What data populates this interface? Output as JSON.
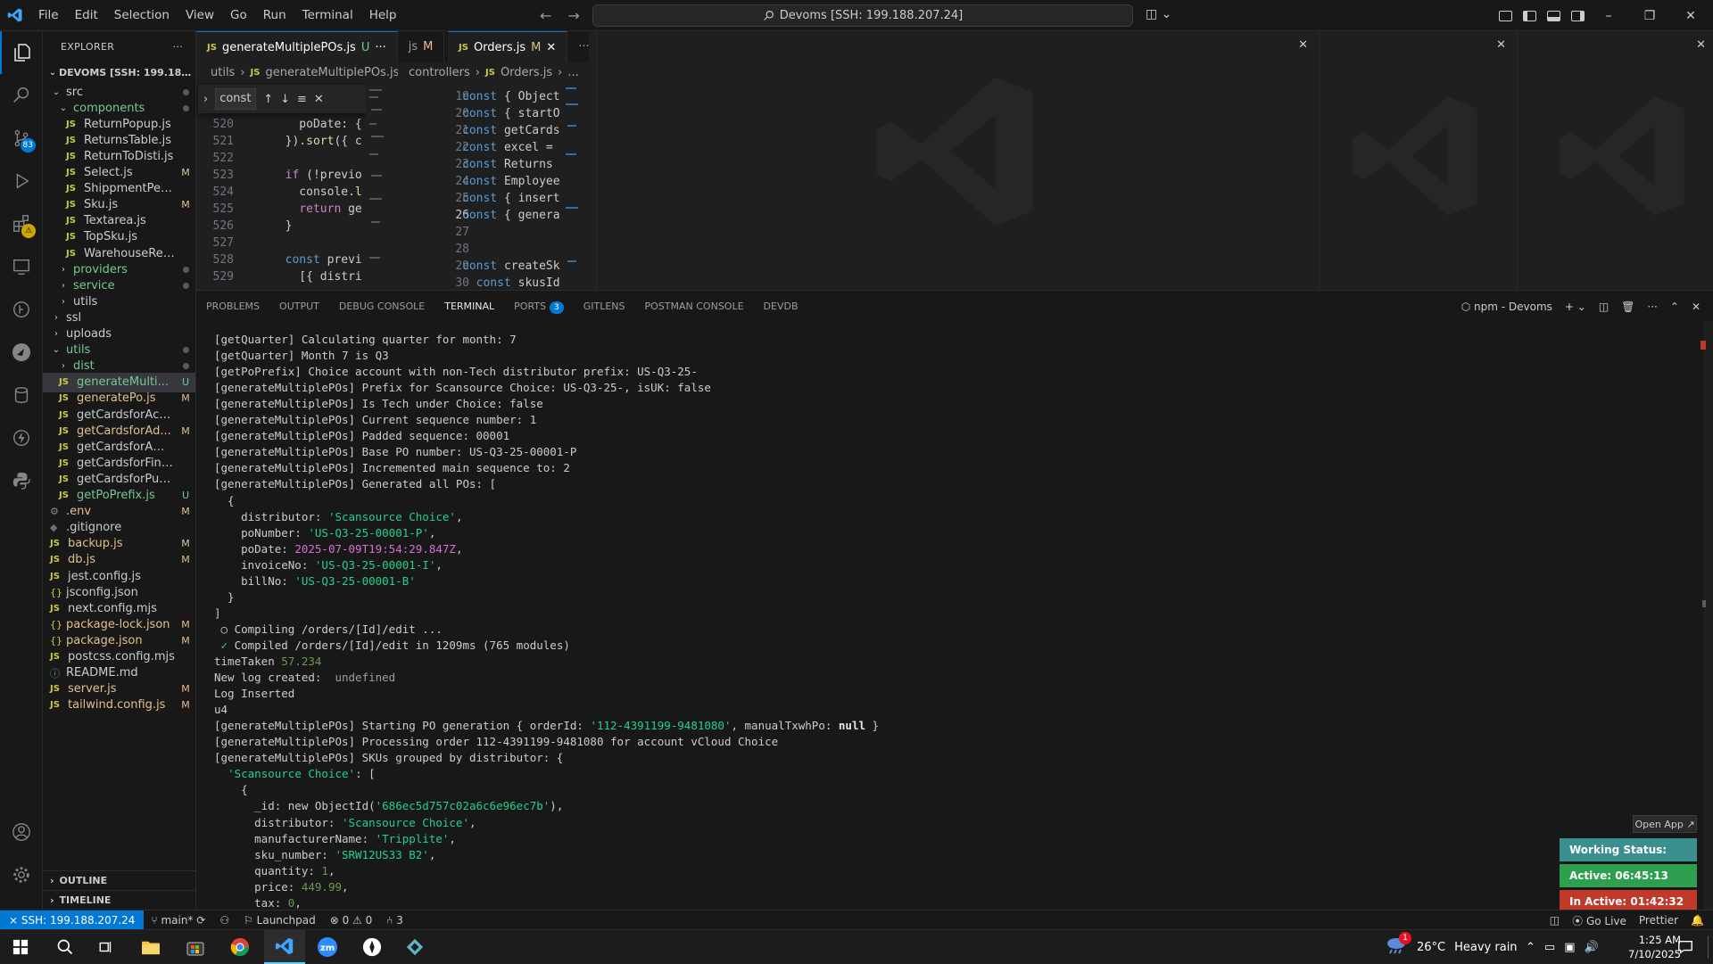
{
  "window": {
    "menu": [
      "File",
      "Edit",
      "Selection",
      "View",
      "Go",
      "Run",
      "Terminal",
      "Help"
    ],
    "command_center": "Devoms [SSH: 199.188.207.24]",
    "controls": {
      "minimize": "–",
      "restore": "❐",
      "close": "✕"
    }
  },
  "explorer": {
    "title": "EXPLORER",
    "root": "DEVOMS [SSH: 199.188.20...",
    "items": [
      {
        "label": "src",
        "type": "folder-open",
        "status": "dot"
      },
      {
        "label": "components",
        "type": "folder-open",
        "status": "dot",
        "mod": true
      },
      {
        "label": "ReturnPopup.js",
        "type": "js",
        "status": ""
      },
      {
        "label": "ReturnsTable.js",
        "type": "js",
        "status": ""
      },
      {
        "label": "ReturnToDisti.js",
        "type": "js",
        "status": ""
      },
      {
        "label": "Select.js",
        "type": "js",
        "status": "M"
      },
      {
        "label": "ShippmentPending...",
        "type": "js",
        "status": ""
      },
      {
        "label": "Sku.js",
        "type": "js",
        "status": "M"
      },
      {
        "label": "Textarea.js",
        "type": "js",
        "status": ""
      },
      {
        "label": "TopSku.js",
        "type": "js",
        "status": ""
      },
      {
        "label": "WarehouseReturn.js",
        "type": "js",
        "status": ""
      },
      {
        "label": "providers",
        "type": "folder",
        "status": "dot",
        "mod": true
      },
      {
        "label": "service",
        "type": "folder",
        "status": "dot",
        "mod": true
      },
      {
        "label": "utils",
        "type": "folder",
        "status": ""
      },
      {
        "label": "ssl",
        "type": "folder",
        "status": ""
      },
      {
        "label": "uploads",
        "type": "folder",
        "status": ""
      },
      {
        "label": "utils",
        "type": "folder-open",
        "status": "dot",
        "mod": true
      },
      {
        "label": "dist",
        "type": "folder",
        "status": "dot",
        "mod": true
      },
      {
        "label": "generateMulti...",
        "type": "js",
        "status": "U",
        "unt": true,
        "selected": true
      },
      {
        "label": "generatePo.js",
        "type": "js",
        "status": "M",
        "mod": true
      },
      {
        "label": "getCardsforAccount.js",
        "type": "js",
        "status": ""
      },
      {
        "label": "getCardsforAd...",
        "type": "js",
        "status": "M",
        "mod": true
      },
      {
        "label": "getCardsforAmazon.js",
        "type": "js",
        "status": ""
      },
      {
        "label": "getCardsforFinance.js",
        "type": "js",
        "status": ""
      },
      {
        "label": "getCardsforPurchasi...",
        "type": "js",
        "status": ""
      },
      {
        "label": "getPoPrefix.js",
        "type": "js",
        "status": "U",
        "unt": true
      },
      {
        "label": ".env",
        "type": "gear",
        "status": "M",
        "mod": true
      },
      {
        "label": ".gitignore",
        "type": "git",
        "status": ""
      },
      {
        "label": "backup.js",
        "type": "js",
        "status": "M",
        "mod": true
      },
      {
        "label": "db.js",
        "type": "js",
        "status": "M",
        "mod": true
      },
      {
        "label": "jest.config.js",
        "type": "js",
        "status": ""
      },
      {
        "label": "jsconfig.json",
        "type": "json",
        "status": ""
      },
      {
        "label": "next.config.mjs",
        "type": "js",
        "status": ""
      },
      {
        "label": "package-lock.json",
        "type": "json",
        "status": "M",
        "mod": true
      },
      {
        "label": "package.json",
        "type": "json",
        "status": "M",
        "mod": true
      },
      {
        "label": "postcss.config.mjs",
        "type": "js",
        "status": ""
      },
      {
        "label": "README.md",
        "type": "info",
        "status": ""
      },
      {
        "label": "server.js",
        "type": "js",
        "status": "M",
        "mod": true
      },
      {
        "label": "tailwind.config.js",
        "type": "js",
        "status": "M",
        "mod": true
      }
    ],
    "outline": "OUTLINE",
    "timeline": "TIMELINE"
  },
  "editor1": {
    "tab_label": "generateMultiplePOs.js",
    "tab_status": "U",
    "tab2_label": "js",
    "tab2_status": "M",
    "bc": [
      "utils",
      "generateMultiplePOs.js"
    ],
    "find_text": "const",
    "lines": [
      {
        "n": "520",
        "t": "    poDate: { $"
      },
      {
        "n": "521",
        "t": "  }).sort({ cre"
      },
      {
        "n": "522",
        "t": ""
      },
      {
        "n": "523",
        "t": "  if (!previous"
      },
      {
        "n": "524",
        "t": "    console.log"
      },
      {
        "n": "525",
        "t": "    return gene"
      },
      {
        "n": "526",
        "t": "  }"
      },
      {
        "n": "527",
        "t": ""
      },
      {
        "n": "528",
        "t": "  const previou"
      },
      {
        "n": "529",
        "t": "    [{ distribu"
      }
    ],
    "partial_lines": [
      "n",
      "ou"
    ]
  },
  "editor2": {
    "tab_label": "Orders.js",
    "tab_status": "M",
    "bc": [
      "controllers",
      "Orders.js",
      "..."
    ],
    "lines": [
      {
        "n": "19",
        "t": "const { Object,"
      },
      {
        "n": "20",
        "t": "const { startO"
      },
      {
        "n": "21",
        "t": "const getCards"
      },
      {
        "n": "22",
        "t": "const excel ="
      },
      {
        "n": "23",
        "t": "const Returns"
      },
      {
        "n": "24",
        "t": "const Employee"
      },
      {
        "n": "25",
        "t": "const { insert"
      },
      {
        "n": "26",
        "t": "const { genera"
      },
      {
        "n": "27",
        "t": ""
      },
      {
        "n": "28",
        "t": ""
      },
      {
        "n": "29",
        "t": "const createSk"
      },
      {
        "n": "30",
        "t": "  const skusId"
      }
    ]
  },
  "panel": {
    "tabs": [
      "PROBLEMS",
      "OUTPUT",
      "DEBUG CONSOLE",
      "TERMINAL",
      "PORTS",
      "GITLENS",
      "POSTMAN CONSOLE",
      "DEVDB"
    ],
    "ports_badge": "3",
    "terminal_name": "npm - Devoms"
  },
  "terminal": {
    "lines": [
      [
        {
          "t": "[getQuarter] Calculating quarter for month: 7"
        }
      ],
      [
        {
          "t": "[getQuarter] Month 7 is Q3"
        }
      ],
      [
        {
          "t": "[getPoPrefix] Choice account with non-Tech distributor prefix: US-Q3-25-"
        }
      ],
      [
        {
          "t": "[generateMultiplePOs] Prefix for Scansource Choice: US-Q3-25-, isUK: false"
        }
      ],
      [
        {
          "t": "[generateMultiplePOs] Is Tech under Choice: false"
        }
      ],
      [
        {
          "t": "[generateMultiplePOs] Current sequence number: 1"
        }
      ],
      [
        {
          "t": "[generateMultiplePOs] Padded sequence: 00001"
        }
      ],
      [
        {
          "t": "[generateMultiplePOs] Base PO number: US-Q3-25-00001-P"
        }
      ],
      [
        {
          "t": "[generateMultiplePOs] Incremented main sequence to: 2"
        }
      ],
      [
        {
          "t": "[generateMultiplePOs] Generated all POs: ["
        }
      ],
      [
        {
          "t": "  {"
        }
      ],
      [
        {
          "t": "    distributor: "
        },
        {
          "t": "'Scansource Choice'",
          "c": "tg"
        },
        {
          "t": ","
        }
      ],
      [
        {
          "t": "    poNumber: "
        },
        {
          "t": "'US-Q3-25-00001-P'",
          "c": "tg"
        },
        {
          "t": ","
        }
      ],
      [
        {
          "t": "    poDate: "
        },
        {
          "t": "2025-07-09T19:54:29.847Z",
          "c": "tm"
        },
        {
          "t": ","
        }
      ],
      [
        {
          "t": "    invoiceNo: "
        },
        {
          "t": "'US-Q3-25-00001-I'",
          "c": "tg"
        },
        {
          "t": ","
        }
      ],
      [
        {
          "t": "    billNo: "
        },
        {
          "t": "'US-Q3-25-00001-B'",
          "c": "tg"
        }
      ],
      [
        {
          "t": "  }"
        }
      ],
      [
        {
          "t": "]"
        }
      ],
      [
        {
          "t": " ○ Compiling /orders/[Id]/edit ..."
        }
      ],
      [
        {
          "t": " ✓",
          "c": "tg"
        },
        {
          "t": " Compiled /orders/[Id]/edit in 1209ms (765 modules)"
        }
      ],
      [
        {
          "t": "timeTaken "
        },
        {
          "t": "57.234",
          "c": "tgo"
        }
      ],
      [
        {
          "t": "New log created:  "
        },
        {
          "t": "undefined",
          "c": "tgr"
        }
      ],
      [
        {
          "t": "Log Inserted"
        }
      ],
      [
        {
          "t": "u4"
        }
      ],
      [
        {
          "t": "[generateMultiplePOs] Starting PO generation { orderId: "
        },
        {
          "t": "'112-4391199-9481080'",
          "c": "tg"
        },
        {
          "t": ", manualTxwhPo: "
        },
        {
          "t": "null",
          "c": "tw"
        },
        {
          "t": " }"
        }
      ],
      [
        {
          "t": "[generateMultiplePOs] Processing order 112-4391199-9481080 for account vCloud Choice"
        }
      ],
      [
        {
          "t": "[generateMultiplePOs] SKUs grouped by distributor: {"
        }
      ],
      [
        {
          "t": "  "
        },
        {
          "t": "'Scansource Choice'",
          "c": "tg"
        },
        {
          "t": ": ["
        }
      ],
      [
        {
          "t": "    {"
        }
      ],
      [
        {
          "t": "      _id: new ObjectId("
        },
        {
          "t": "'686ec5d757c02a6c6e96ec7b'",
          "c": "tg"
        },
        {
          "t": "),"
        }
      ],
      [
        {
          "t": "      distributor: "
        },
        {
          "t": "'Scansource Choice'",
          "c": "tg"
        },
        {
          "t": ","
        }
      ],
      [
        {
          "t": "      manufacturerName: "
        },
        {
          "t": "'Tripplite'",
          "c": "tg"
        },
        {
          "t": ","
        }
      ],
      [
        {
          "t": "      sku_number: "
        },
        {
          "t": "'SRW12US33 B2'",
          "c": "tg"
        },
        {
          "t": ","
        }
      ],
      [
        {
          "t": "      quantity: "
        },
        {
          "t": "1",
          "c": "tgo"
        },
        {
          "t": ","
        }
      ],
      [
        {
          "t": "      price: "
        },
        {
          "t": "449.99",
          "c": "tgo"
        },
        {
          "t": ","
        }
      ],
      [
        {
          "t": "      tax: "
        },
        {
          "t": "0",
          "c": "tgo"
        },
        {
          "t": ","
        }
      ]
    ]
  },
  "work_status": {
    "open_app": "Open App ↗",
    "status": "Working Status: Active",
    "active": "Active: 06:45:13",
    "inactive": "In Active: 01:42:32",
    "colors": {
      "status": "#3b8f8f",
      "active": "#2e9e4f",
      "inactive": "#c0392b"
    }
  },
  "statusbar": {
    "remote": "SSH: 199.188.207.24",
    "branch": "main*",
    "launchpad": "Launchpad",
    "errors": "0",
    "warnings": "0",
    "ports": "3",
    "golive": "Go Live",
    "prettier": "Prettier"
  },
  "taskbar": {
    "weather_temp": "26°C",
    "weather_desc": "Heavy rain",
    "weather_badge": "1",
    "time": "1:25 AM",
    "date": "7/10/2025"
  },
  "activity_badges": {
    "scm": "83"
  },
  "accent": "#0078d4"
}
